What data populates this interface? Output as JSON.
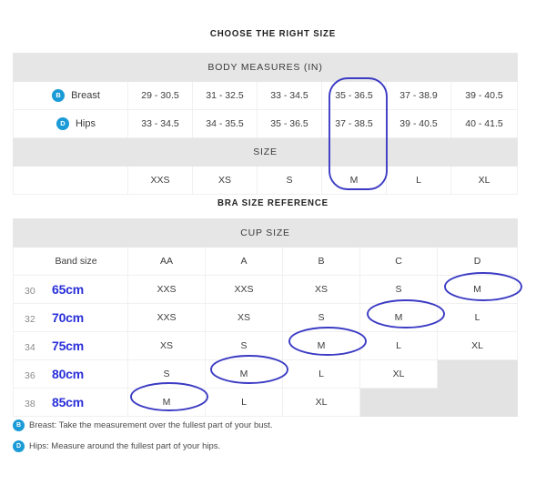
{
  "headings": {
    "choose": "CHOOSE THE RIGHT SIZE",
    "bra": "BRA SIZE REFERENCE"
  },
  "body_table": {
    "header": "BODY MEASURES (IN)",
    "size_header": "SIZE",
    "rows": [
      {
        "badge": "B",
        "label": "Breast",
        "values": [
          "29 - 30.5",
          "31 - 32.5",
          "33 - 34.5",
          "35 - 36.5",
          "37 - 38.9",
          "39 - 40.5"
        ]
      },
      {
        "badge": "D",
        "label": "Hips",
        "values": [
          "33 - 34.5",
          "34 - 35.5",
          "35 - 36.5",
          "37 - 38.5",
          "39 - 40.5",
          "40 - 41.5"
        ]
      }
    ],
    "size_row": {
      "label": "",
      "values": [
        "XXS",
        "XS",
        "S",
        "M",
        "L",
        "XL"
      ]
    }
  },
  "bra_table": {
    "header": "CUP SIZE",
    "band_label": "Band size",
    "cup_columns": [
      "AA",
      "A",
      "B",
      "C",
      "D"
    ],
    "rows": [
      {
        "band": "30",
        "cm": "65cm",
        "values": [
          "XXS",
          "XXS",
          "XS",
          "S",
          "M"
        ]
      },
      {
        "band": "32",
        "cm": "70cm",
        "values": [
          "XXS",
          "XS",
          "S",
          "M",
          "L"
        ]
      },
      {
        "band": "34",
        "cm": "75cm",
        "values": [
          "XS",
          "S",
          "M",
          "L",
          "XL"
        ]
      },
      {
        "band": "36",
        "cm": "80cm",
        "values": [
          "S",
          "M",
          "L",
          "XL",
          ""
        ]
      },
      {
        "band": "38",
        "cm": "85cm",
        "values": [
          "M",
          "L",
          "XL",
          "",
          ""
        ]
      }
    ]
  },
  "footnotes": [
    {
      "badge": "B",
      "text": "Breast: Take the measurement over the fullest part of your bust."
    },
    {
      "badge": "D",
      "text": "Hips: Measure around the fullest part of your hips."
    }
  ],
  "colors": {
    "badge_blue": "#1a9bd7",
    "annotation_blue": "#3b3bc4",
    "cm_blue": "#2a30d8",
    "header_grey": "#e6e6e6",
    "disabled_grey": "#e3e3e3"
  },
  "annotations": {
    "body_highlight": "M column rounded rectangle",
    "bra_highlights": [
      "30/D",
      "32/C",
      "34/B",
      "36/A",
      "38/AA"
    ]
  }
}
